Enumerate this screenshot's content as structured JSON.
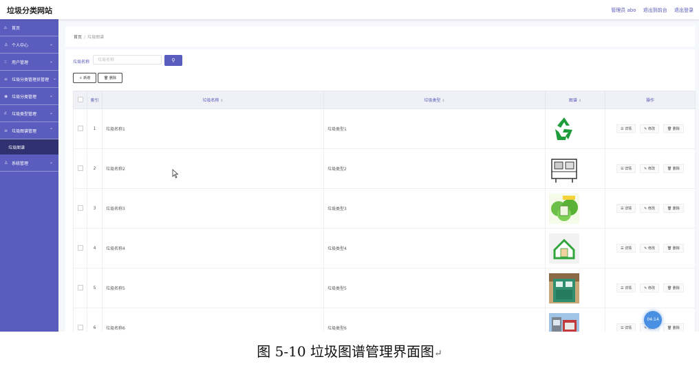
{
  "header": {
    "brand": "垃圾分类网站",
    "nav": [
      "管理员 abo",
      "退出到前台",
      "退出登录"
    ]
  },
  "sidebar": {
    "items": [
      {
        "icon": "home-icon",
        "glyph": "⌂",
        "label": "首页",
        "chevron": ""
      },
      {
        "icon": "user-icon",
        "glyph": "♙",
        "label": "个人中心",
        "chevron": "⌄"
      },
      {
        "icon": "grid-icon",
        "glyph": "⁝⁝",
        "label": "用户管理",
        "chevron": "⌄"
      },
      {
        "icon": "list-icon",
        "glyph": "≡",
        "label": "垃圾分类管理员管理",
        "chevron": "⌄"
      },
      {
        "icon": "pin-icon",
        "glyph": "◉",
        "label": "垃圾分类管理",
        "chevron": "⌄"
      },
      {
        "icon": "chart-icon",
        "glyph": "ıl",
        "label": "垃圾类型管理",
        "chevron": "⌄"
      },
      {
        "icon": "list-icon",
        "glyph": "≡",
        "label": "垃圾图谱管理",
        "chevron": "⌃"
      }
    ],
    "submenu_active": "垃圾图谱",
    "last_item": {
      "icon": "person-icon",
      "glyph": "♙",
      "label": "系统管理",
      "chevron": "⌄"
    }
  },
  "breadcrumb": {
    "home": "首页",
    "separator": "/",
    "current": "垃圾图谱"
  },
  "search": {
    "label": "垃圾名称",
    "placeholder": "垃圾名称",
    "button_icon": "search-icon",
    "button_glyph": "⚲"
  },
  "actions": {
    "add_label": "＋ 新增",
    "delete_label": "🗑 删除"
  },
  "table": {
    "headers": {
      "index": "索引",
      "name": "垃圾名称",
      "type": "垃圾类型",
      "image": "图谱",
      "ops": "操作"
    },
    "sort_glyph": "⇕",
    "rows": [
      {
        "index": "1",
        "name": "垃圾名称1",
        "type": "垃圾类型1",
        "image": "recycle-symbol-image"
      },
      {
        "index": "2",
        "name": "垃圾名称2",
        "type": "垃圾类型2",
        "image": "machine-illustration-image"
      },
      {
        "index": "3",
        "name": "垃圾名称3",
        "type": "垃圾类型3",
        "image": "green-bin-image"
      },
      {
        "index": "4",
        "name": "垃圾名称4",
        "type": "垃圾类型4",
        "image": "house-sign-image"
      },
      {
        "index": "5",
        "name": "垃圾名称5",
        "type": "垃圾类型5",
        "image": "smart-bin-photo"
      },
      {
        "index": "6",
        "name": "垃圾名称6",
        "type": "垃圾类型6",
        "image": "sorting-station-photo"
      }
    ],
    "op_labels": {
      "detail": "详情",
      "edit": "修改",
      "delete": "删除"
    },
    "op_glyphs": {
      "detail": "☰",
      "edit": "✎",
      "delete": "🗑"
    }
  },
  "timer": "04:14",
  "caption": "图 5-10 垃圾图谱管理界面图",
  "caption_mark": "↵",
  "colors": {
    "accent": "#5a5dbd",
    "submenu_bg": "#2f3170",
    "timer": "#4a90e2"
  }
}
